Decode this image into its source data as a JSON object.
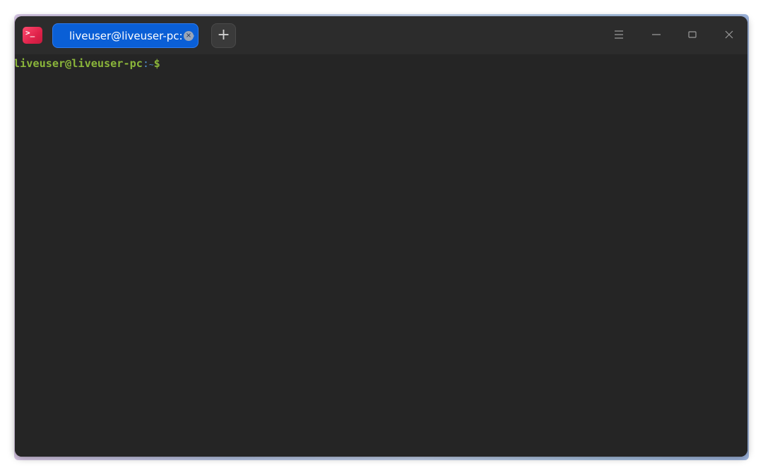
{
  "app": {
    "icon": "terminal-icon",
    "accent_color": "#0a5fd6",
    "icon_color": "#e0224a"
  },
  "tabs": [
    {
      "label": "liveuser@liveuser-pc: ~",
      "active": true,
      "close_icon": "close-circle-icon"
    }
  ],
  "new_tab": {
    "label": "+",
    "icon": "plus-icon"
  },
  "window_controls": {
    "menu_icon": "hamburger-menu-icon",
    "minimize_icon": "minimize-icon",
    "maximize_icon": "maximize-icon",
    "close_icon": "close-icon"
  },
  "terminal": {
    "prompt": {
      "user_host": "liveuser@liveuser-pc",
      "colon": ":",
      "path": "~",
      "symbol": "$"
    },
    "user_host_color": "#8ab53a",
    "path_color": "#4f8fd1",
    "background": "#252525"
  }
}
